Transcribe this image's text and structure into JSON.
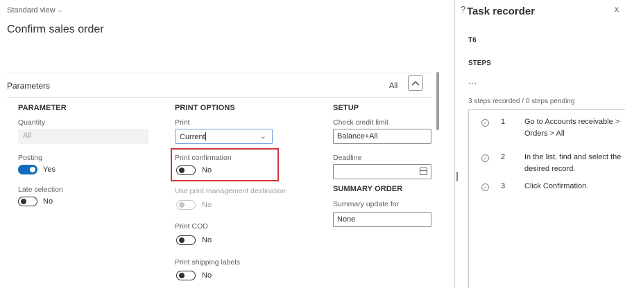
{
  "header": {
    "view_label": "Standard view",
    "page_title": "Confirm sales order",
    "help_glyph": "?"
  },
  "parameters": {
    "title": "Parameters",
    "filter_label": "All",
    "parameter_group": {
      "header": "PARAMETER",
      "quantity_label": "Quantity",
      "quantity_value": "All",
      "posting_label": "Posting",
      "posting_value": "Yes",
      "posting_on": true,
      "late_selection_label": "Late selection",
      "late_selection_value": "No",
      "late_selection_on": false
    },
    "print_options_group": {
      "header": "PRINT OPTIONS",
      "print_label": "Print",
      "print_value": "Current",
      "print_confirmation_label": "Print confirmation",
      "print_confirmation_value": "No",
      "use_print_mgmt_label": "Use print management destination",
      "use_print_mgmt_value": "No",
      "print_cod_label": "Print COD",
      "print_cod_value": "No",
      "print_shipping_labels_label": "Print shipping labels",
      "print_shipping_labels_value": "No"
    },
    "setup_group": {
      "header": "SETUP",
      "check_credit_limit_label": "Check credit limit",
      "check_credit_limit_value": "Balance+All",
      "deadline_label": "Deadline",
      "deadline_value": ""
    },
    "summary_order_group": {
      "header": "SUMMARY ORDER",
      "summary_update_label": "Summary update for",
      "summary_update_value": "None"
    }
  },
  "task_recorder": {
    "title": "Task recorder",
    "close_glyph": "x",
    "recording_name": "T6",
    "steps_header": "STEPS",
    "more_glyph": "...",
    "status": "3 steps recorded / 0 steps pending",
    "steps": [
      {
        "number": "1",
        "text": "Go to Accounts receivable > Orders > All"
      },
      {
        "number": "2",
        "text": "In the list, find and select the desired record."
      },
      {
        "number": "3",
        "text": "Click Confirmation."
      }
    ]
  },
  "colors": {
    "accent": "#0f6cbd",
    "highlight": "#d13438"
  }
}
